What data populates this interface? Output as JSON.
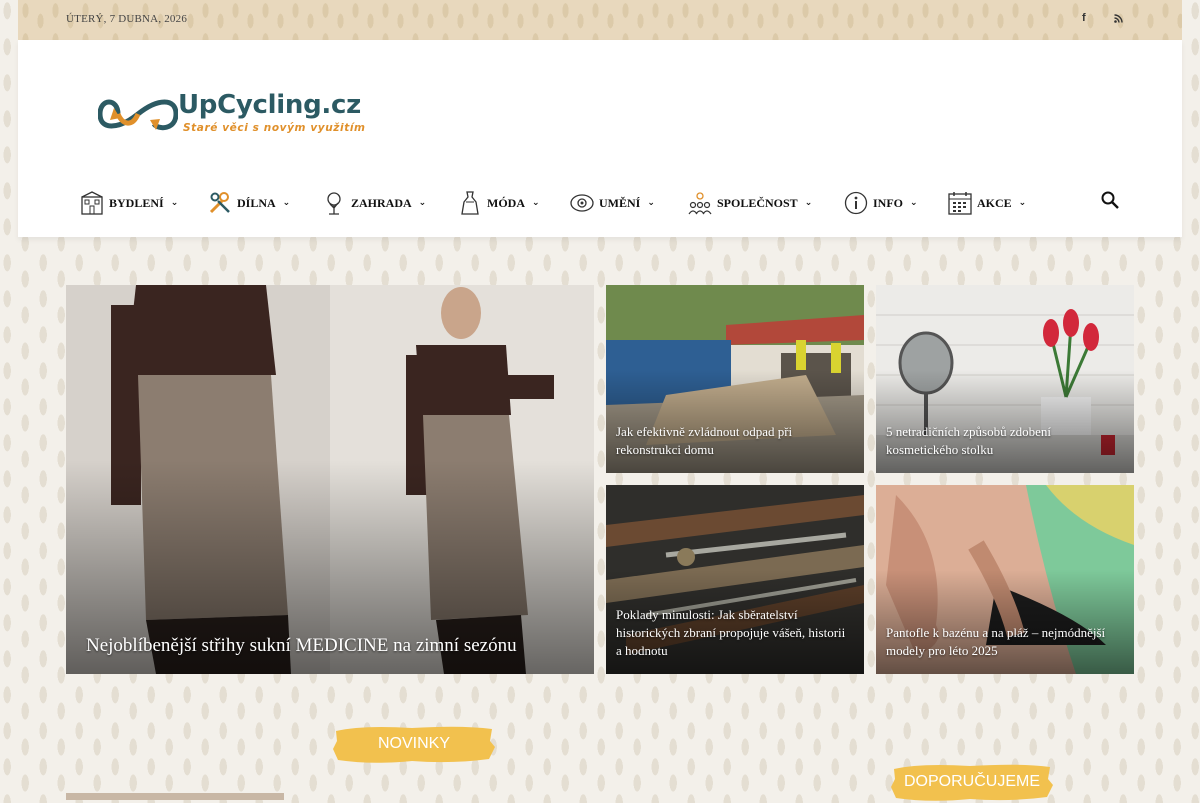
{
  "topbar": {
    "date": "ÚTERÝ, 7 DUBNA, 2026",
    "social": [
      "facebook-icon",
      "rss-icon"
    ]
  },
  "logo": {
    "name": "UpCycling.cz",
    "tagline": "Staré věci s novým využitím"
  },
  "nav": [
    {
      "label": "BYDLENÍ",
      "icon": "house-icon"
    },
    {
      "label": "DÍLNA",
      "icon": "tools-icon"
    },
    {
      "label": "ZAHRADA",
      "icon": "tree-icon"
    },
    {
      "label": "MÓDA",
      "icon": "dress-icon"
    },
    {
      "label": "UMĚNÍ",
      "icon": "eye-icon"
    },
    {
      "label": "SPOLEČNOST",
      "icon": "people-icon"
    },
    {
      "label": "INFO",
      "icon": "info-icon"
    },
    {
      "label": "AKCE",
      "icon": "calendar-icon"
    }
  ],
  "featured": [
    {
      "title": "Nejoblíbenější střihy sukní MEDICINE na zimní sezónu"
    },
    {
      "title": "Jak efektivně zvládnout odpad při rekonstrukci domu"
    },
    {
      "title": "5 netradičních způsobů zdobení kosmetického stolku"
    },
    {
      "title": "Poklady minulosti: Jak sběratelství historických zbraní propojuje vášeň, historii a hodnotu"
    },
    {
      "title": "Pantofle k bazénu a na pláž – nejmódnější modely pro léto 2025"
    }
  ],
  "sections": {
    "news": "NOVINKY",
    "recommended": "DOPORUČUJEME"
  },
  "colors": {
    "brush": "#f2c14e",
    "logo_text": "#2c5a63",
    "logo_accent": "#e0902b"
  }
}
